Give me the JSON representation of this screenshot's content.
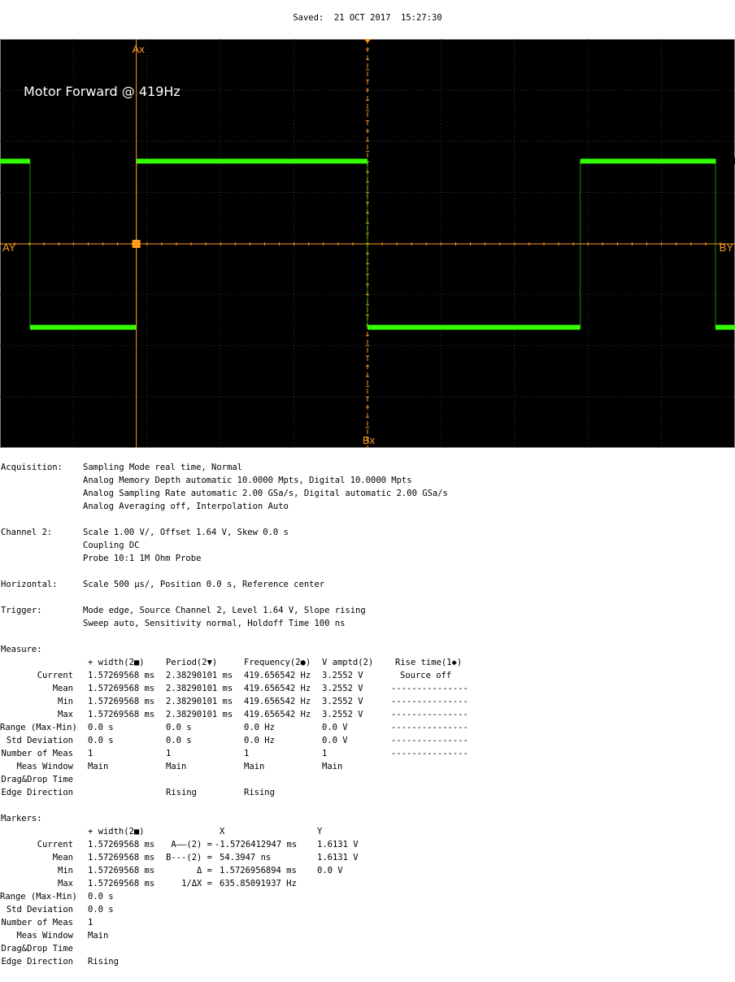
{
  "header": {
    "saved": "Saved:  21 OCT 2017  15:27:30"
  },
  "scope": {
    "annotation": "Motor Forward @ 419Hz",
    "markers": {
      "ax": "Ax",
      "bx": "Bx",
      "ay": "AY",
      "by": "BY"
    },
    "colors": {
      "trace": "#33ff00",
      "cursor": "#ff9a1e",
      "grid": "#3a3a3a",
      "background": "#000000",
      "frame": "#808080"
    }
  },
  "chart_data": {
    "type": "line",
    "title": "Motor Forward @ 419Hz",
    "xlabel": "",
    "ylabel": "",
    "x_unit": "µs",
    "y_unit": "V",
    "xlim": [
      -2500,
      2500
    ],
    "ylim": [
      -2.36,
      5.64
    ],
    "grid": true,
    "series": [
      {
        "x": [
          -2500,
          -2296,
          -2296,
          -1572.6,
          -1572.6,
          0,
          0,
          1447.4,
          1447.4,
          2500
        ],
        "values": [
          3.25,
          3.25,
          0,
          0,
          3.25,
          3.25,
          0,
          0,
          3.25,
          3.25
        ]
      }
    ],
    "segments_after": {
      "x": [
        2500,
        2500
      ],
      "values": [
        0,
        0
      ]
    }
  },
  "settings": {
    "acquisition": {
      "label": "Acquisition:",
      "lines": [
        "Sampling Mode real time, Normal",
        "Analog Memory Depth automatic 10.0000 Mpts, Digital 10.0000 Mpts",
        "Analog Sampling Rate automatic 2.00 GSa/s, Digital automatic 2.00 GSa/s",
        "Analog Averaging off, Interpolation Auto"
      ]
    },
    "channel2": {
      "label": "Channel 2:",
      "lines": [
        "Scale 1.00 V/, Offset 1.64 V, Skew 0.0 s",
        "Coupling DC",
        "Probe 10:1 1M Ohm Probe"
      ]
    },
    "horizontal": {
      "label": "Horizontal:",
      "lines": [
        "Scale 500 µs/, Position 0.0 s, Reference center"
      ]
    },
    "trigger": {
      "label": "Trigger:",
      "lines": [
        "Mode edge, Source Channel 2, Level 1.64 V, Slope rising",
        "Sweep auto, Sensitivity normal, Holdoff Time 100 ns"
      ]
    }
  },
  "measure": {
    "label": "Measure:",
    "headers": [
      "+ width(2■)",
      "Period(2▼)",
      "Frequency(2●)",
      "V amptd(2)",
      "Rise time(1◆)"
    ],
    "rows": [
      {
        "label": "Current",
        "cells": [
          "1.57269568 ms",
          "2.38290101 ms",
          "419.656542 Hz",
          "3.2552 V",
          "Source off"
        ]
      },
      {
        "label": "Mean",
        "cells": [
          "1.57269568 ms",
          "2.38290101 ms",
          "419.656542 Hz",
          "3.2552 V",
          "---------------"
        ]
      },
      {
        "label": "Min",
        "cells": [
          "1.57269568 ms",
          "2.38290101 ms",
          "419.656542 Hz",
          "3.2552 V",
          "---------------"
        ]
      },
      {
        "label": "Max",
        "cells": [
          "1.57269568 ms",
          "2.38290101 ms",
          "419.656542 Hz",
          "3.2552 V",
          "---------------"
        ]
      },
      {
        "label": "Range (Max-Min)",
        "cells": [
          "0.0 s",
          "0.0 s",
          "0.0 Hz",
          "0.0 V",
          "---------------"
        ]
      },
      {
        "label": "Std Deviation",
        "cells": [
          "0.0 s",
          "0.0 s",
          "0.0 Hz",
          "0.0 V",
          "---------------"
        ]
      },
      {
        "label": "Number of Meas",
        "cells": [
          "1",
          "1",
          "1",
          "1",
          "---------------"
        ]
      },
      {
        "label": "Meas Window",
        "cells": [
          "Main",
          "Main",
          "Main",
          "Main",
          ""
        ]
      },
      {
        "label": "Drag&Drop Time",
        "cells": [
          "",
          "",
          "",
          "",
          ""
        ]
      },
      {
        "label": "Edge Direction",
        "cells": [
          "",
          "Rising",
          "Rising",
          "",
          ""
        ]
      }
    ]
  },
  "markers": {
    "label": "Markers:",
    "headers": [
      "+ width(2■)",
      "X",
      "Y"
    ],
    "rows": [
      {
        "label": "Current",
        "width": "1.57269568 ms",
        "x_name": "A——(2) =",
        "x_val": "-1.5726412947 ms",
        "y_val": "1.6131 V"
      },
      {
        "label": "Mean",
        "width": "1.57269568 ms",
        "x_name": "B---(2) =",
        "x_val": "54.3947 ns",
        "y_val": "1.6131 V"
      },
      {
        "label": "Min",
        "width": "1.57269568 ms",
        "x_name": "Δ =",
        "x_val": "1.5726956894 ms",
        "y_val": "0.0 V"
      },
      {
        "label": "Max",
        "width": "1.57269568 ms",
        "x_name": "1/ΔX =",
        "x_val": "635.85091937 Hz",
        "y_val": ""
      },
      {
        "label": "Range (Max-Min)",
        "width": "0.0 s",
        "x_name": "",
        "x_val": "",
        "y_val": ""
      },
      {
        "label": "Std Deviation",
        "width": "0.0 s",
        "x_name": "",
        "x_val": "",
        "y_val": ""
      },
      {
        "label": "Number of Meas",
        "width": "1",
        "x_name": "",
        "x_val": "",
        "y_val": ""
      },
      {
        "label": "Meas Window",
        "width": "Main",
        "x_name": "",
        "x_val": "",
        "y_val": ""
      },
      {
        "label": "Drag&Drop Time",
        "width": "",
        "x_name": "",
        "x_val": "",
        "y_val": ""
      },
      {
        "label": "Edge Direction",
        "width": "Rising",
        "x_name": "",
        "x_val": "",
        "y_val": ""
      }
    ]
  }
}
